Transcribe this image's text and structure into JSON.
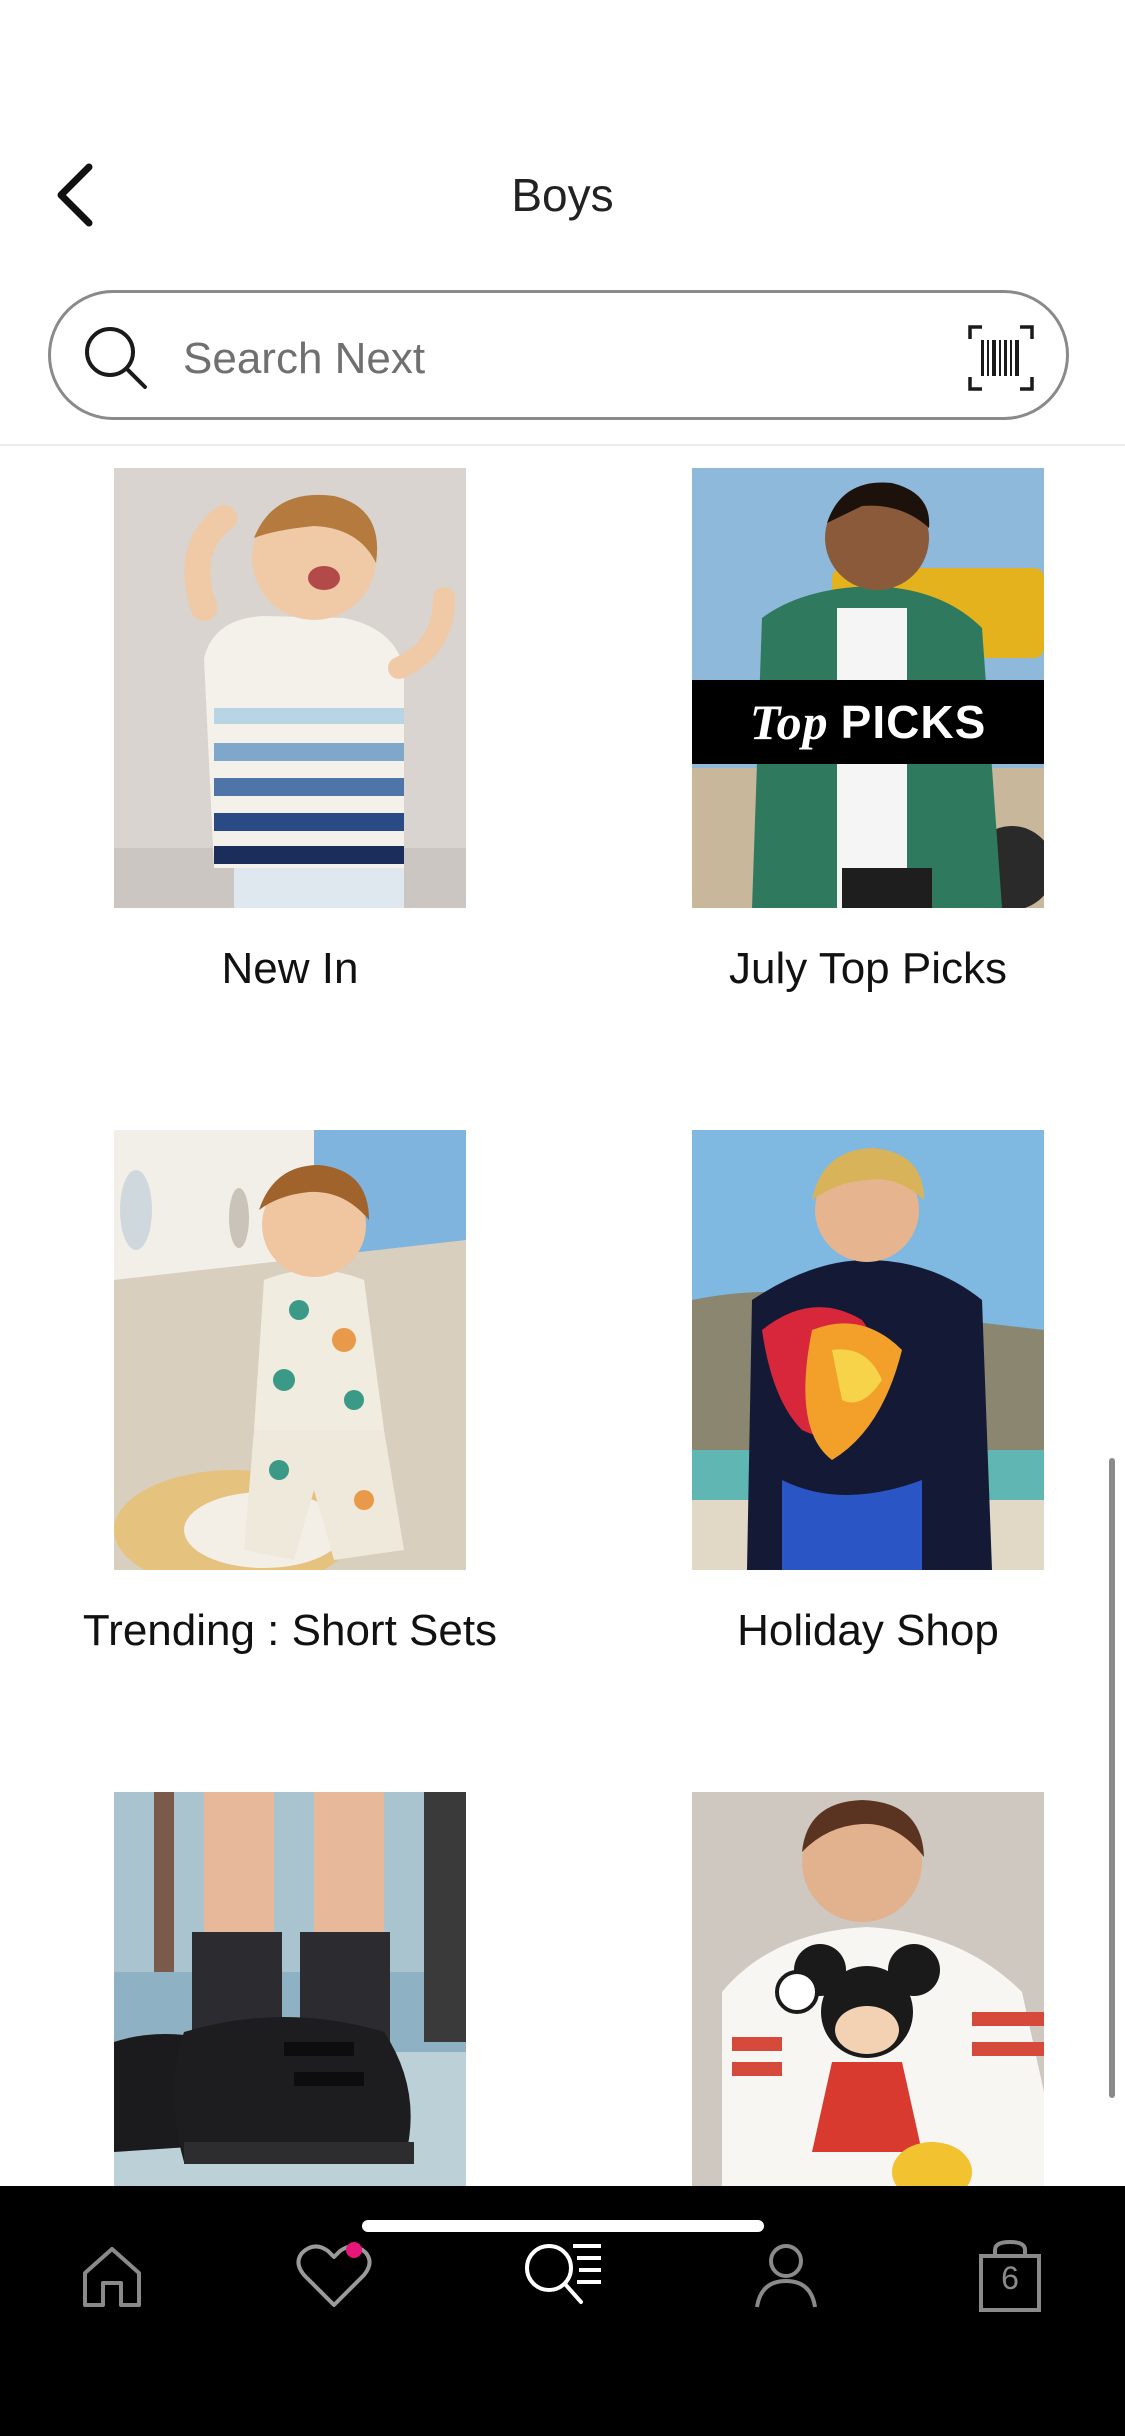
{
  "header": {
    "title": "Boys"
  },
  "search": {
    "placeholder": "Search Next",
    "value": ""
  },
  "tiles": [
    {
      "label": "New In"
    },
    {
      "label": "July Top Picks",
      "badge_script": "Top",
      "badge_text": "PICKS"
    },
    {
      "label": "Trending : Short Sets"
    },
    {
      "label": "Holiday Shop"
    },
    {
      "label": ""
    },
    {
      "label": ""
    }
  ],
  "tabbar": {
    "items": [
      "home",
      "favourites",
      "browse",
      "account",
      "bag"
    ],
    "bag_count": "6",
    "active": "browse"
  },
  "colors": {
    "accent_dot": "#e8157b",
    "tabbar_bg": "#000000"
  }
}
